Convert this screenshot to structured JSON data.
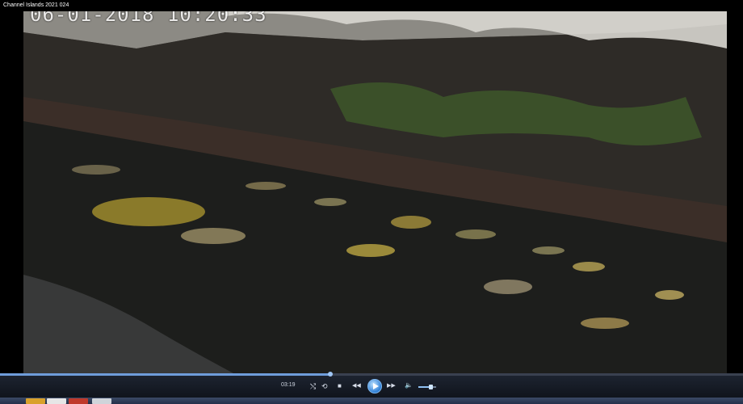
{
  "window": {
    "title": "Channel Islands 2021 024"
  },
  "video": {
    "timestamp": "06-01-2018  10:20:33",
    "description_icon": "video-frame"
  },
  "player": {
    "current_time": "03:19",
    "progress": 0.445,
    "volume": 0.7,
    "buttons": {
      "shuffle": "⤭",
      "repeat": "⟲",
      "stop": "■",
      "previous": "◀◀",
      "next": "▶▶",
      "volume": "🔈"
    },
    "accent_color": "#2e7fd6"
  },
  "taskbar": {
    "icons": [
      "start-icon",
      "explorer-icon",
      "media-player-icon",
      "browser-icon"
    ]
  }
}
